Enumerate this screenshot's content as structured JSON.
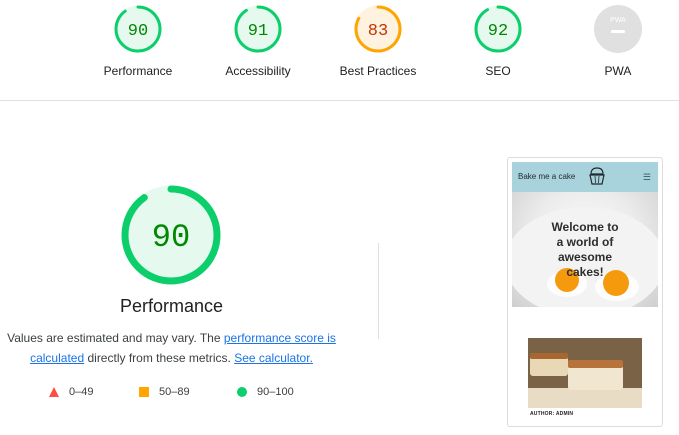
{
  "top_scores": [
    {
      "name": "Performance",
      "score": "90",
      "status": "pass"
    },
    {
      "name": "Accessibility",
      "score": "91",
      "status": "pass"
    },
    {
      "name": "Best Practices",
      "score": "83",
      "status": "average"
    },
    {
      "name": "SEO",
      "score": "92",
      "status": "pass"
    },
    {
      "name": "PWA",
      "score": "PWA",
      "status": "na"
    }
  ],
  "performance": {
    "score": "90",
    "title": "Performance",
    "desc_prefix": "Values are estimated and may vary. The ",
    "score_link": "performance score is calculated",
    "desc_middle": " directly from these metrics. ",
    "calculator_link": "See calculator."
  },
  "legend": [
    {
      "range": "0–49",
      "icon": "red-triangle-icon"
    },
    {
      "range": "50–89",
      "icon": "orange-square-icon"
    },
    {
      "range": "90–100",
      "icon": "green-circle-icon"
    }
  ],
  "preview": {
    "brand": "Bake me a cake",
    "hero_line1": "Welcome to",
    "hero_line2": "a world of",
    "hero_line3": "awesome",
    "hero_line4": "cakes!",
    "author": "AUTHOR: ADMIN"
  },
  "colors": {
    "pass": "#0cce6b",
    "pass_text": "#008800",
    "pass_bg": "#e6f9ee",
    "average": "#ffa400",
    "average_text": "#c33300",
    "average_bg": "#fff3e0",
    "fail": "#ff4e42",
    "na": "#e0e0e0"
  }
}
